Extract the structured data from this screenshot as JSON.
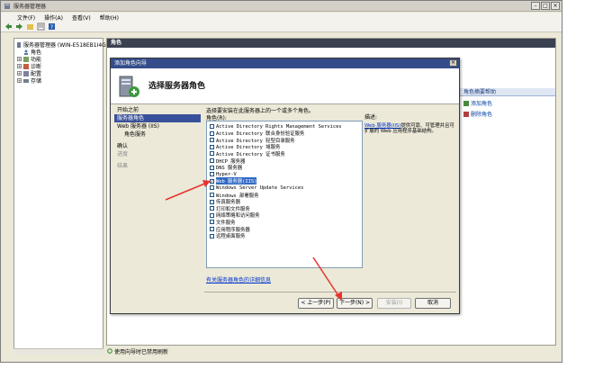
{
  "window": {
    "title": "服务器管理器"
  },
  "menubar": [
    "文件(F)",
    "操作(A)",
    "查看(V)",
    "帮助(H)"
  ],
  "tree": {
    "root": "服务器管理器 (WIN-E518EB1I4G",
    "items": [
      "角色",
      "功能",
      "诊断",
      "配置",
      "存储"
    ]
  },
  "main": {
    "header": "角色",
    "right_panel": {
      "header": "角色摘要帮助",
      "links": [
        "添加角色",
        "删除角色"
      ]
    },
    "status": "使用向导时已禁用刷新"
  },
  "dialog": {
    "title": "添加角色向导",
    "header": "选择服务器角色",
    "steps": [
      {
        "label": "开始之前",
        "state": "normal"
      },
      {
        "label": "服务器角色",
        "state": "active"
      },
      {
        "label": "Web 服务器 (IIS)",
        "state": "normal"
      },
      {
        "label": "角色服务",
        "state": "sub"
      },
      {
        "label": "确认",
        "state": "normal"
      },
      {
        "label": "进度",
        "state": "disabled"
      },
      {
        "label": "结果",
        "state": "disabled"
      }
    ],
    "instruction": "选择要安装在此服务器上的一个或多个角色。",
    "roles_label": "角色(R):",
    "roles": [
      {
        "label": "Active Directory Rights Management Services",
        "checked": false
      },
      {
        "label": "Active Directory 联合身份验证服务",
        "checked": false
      },
      {
        "label": "Active Directory 轻型目录服务",
        "checked": false
      },
      {
        "label": "Active Directory 域服务",
        "checked": false
      },
      {
        "label": "Active Directory 证书服务",
        "checked": false
      },
      {
        "label": "DHCP 服务器",
        "checked": false
      },
      {
        "label": "DNS 服务器",
        "checked": false
      },
      {
        "label": "Hyper-V",
        "checked": false
      },
      {
        "label": "Web 服务器(IIS)",
        "checked": true,
        "selected": true
      },
      {
        "label": "Windows Server Update Services",
        "checked": false
      },
      {
        "label": "Windows 部署服务",
        "checked": false
      },
      {
        "label": "传真服务器",
        "checked": false
      },
      {
        "label": "打印和文件服务",
        "checked": false
      },
      {
        "label": "网络策略和访问服务",
        "checked": false
      },
      {
        "label": "文件服务",
        "checked": false
      },
      {
        "label": "应用程序服务器",
        "checked": false
      },
      {
        "label": "远程桌面服务",
        "checked": false
      }
    ],
    "description": {
      "label": "描述:",
      "link": "Web 服务器(IIS)",
      "text": "提供可靠、可管理并且可扩展的 Web 应用程序基础结构。"
    },
    "more_link": "有关服务器角色的详细信息",
    "buttons": {
      "back": "< 上一步(P)",
      "next": "下一步(N) >",
      "install": "安装(I)",
      "cancel": "取消"
    }
  },
  "colors": {
    "dialog_title": "#344c8a",
    "active_step": "#39509a",
    "selection": "#316ac5",
    "annotation_arrow": "#e8332c"
  }
}
